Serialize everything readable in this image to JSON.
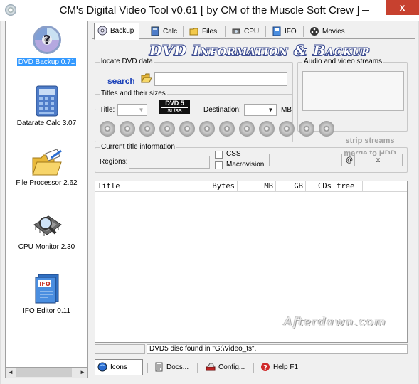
{
  "window": {
    "title": "CM's Digital Video Tool v0.61   [ by CM of the Muscle Soft Crew ]",
    "close_glyph": "x"
  },
  "sidebar": {
    "items": [
      {
        "label": "DVD Backup 0.71",
        "icon": "dvd-disc-icon",
        "selected": true
      },
      {
        "label": "Datarate Calc 3.07",
        "icon": "calculator-icon",
        "selected": false
      },
      {
        "label": "File Processor 2.62",
        "icon": "folders-icon",
        "selected": false
      },
      {
        "label": "CPU Monitor 2.30",
        "icon": "cpu-chip-icon",
        "selected": false
      },
      {
        "label": "IFO Editor 0.11",
        "icon": "ifo-file-icon",
        "selected": false
      }
    ],
    "scroll_left": "◄",
    "scroll_right": "►"
  },
  "tabs": [
    {
      "label": "Backup",
      "icon": "disc-icon",
      "active": true
    },
    {
      "label": "Calc",
      "icon": "calc-icon",
      "active": false
    },
    {
      "label": "Files",
      "icon": "files-icon",
      "active": false
    },
    {
      "label": "CPU",
      "icon": "cpu-icon",
      "active": false
    },
    {
      "label": "IFO",
      "icon": "ifo-icon",
      "active": false
    },
    {
      "label": "Movies",
      "icon": "movie-reel-icon",
      "active": false
    }
  ],
  "banner": "DVD Information & Backup",
  "locate": {
    "group_label": "locate DVD data",
    "search_label": "search",
    "path_value": ""
  },
  "streams": {
    "group_label": "Audio and video streams"
  },
  "titles": {
    "group_label": "Titles and their sizes",
    "title_label": "Title:",
    "title_value": "",
    "dvd_badge_line1": "DVD 5",
    "dvd_badge_line2": "SL/SS",
    "destination_label": "Destination:",
    "destination_value": "",
    "unit_label": "MB",
    "disc_count": 12,
    "strip_label": "strip streams",
    "merge_label": "merge to HDD"
  },
  "current": {
    "group_label": "Current title information",
    "regions_label": "Regions:",
    "regions_value": "",
    "css_label": "CSS",
    "macrovision_label": "Macrovision",
    "at_label": "@",
    "x_label": "x"
  },
  "list": {
    "columns": [
      "Title",
      "Bytes",
      "MB",
      "GB",
      "CDs",
      "free"
    ],
    "rows": []
  },
  "watermark": "Afterdawn.com",
  "status": {
    "left": "",
    "message": "DVD5 disc found in \"G:\\Video_ts\"."
  },
  "bottom_buttons": [
    {
      "label": "Icons",
      "icon": "globe-icon",
      "active": true
    },
    {
      "label": "Docs...",
      "icon": "docs-icon",
      "active": false
    },
    {
      "label": "Config...",
      "icon": "config-icon",
      "active": false
    },
    {
      "label": "Help F1",
      "icon": "help-icon",
      "active": false
    }
  ],
  "colors": {
    "selection": "#3399ff",
    "link": "#1a40b8",
    "close_button": "#c7412f",
    "banner_outline": "#3a4a90"
  }
}
